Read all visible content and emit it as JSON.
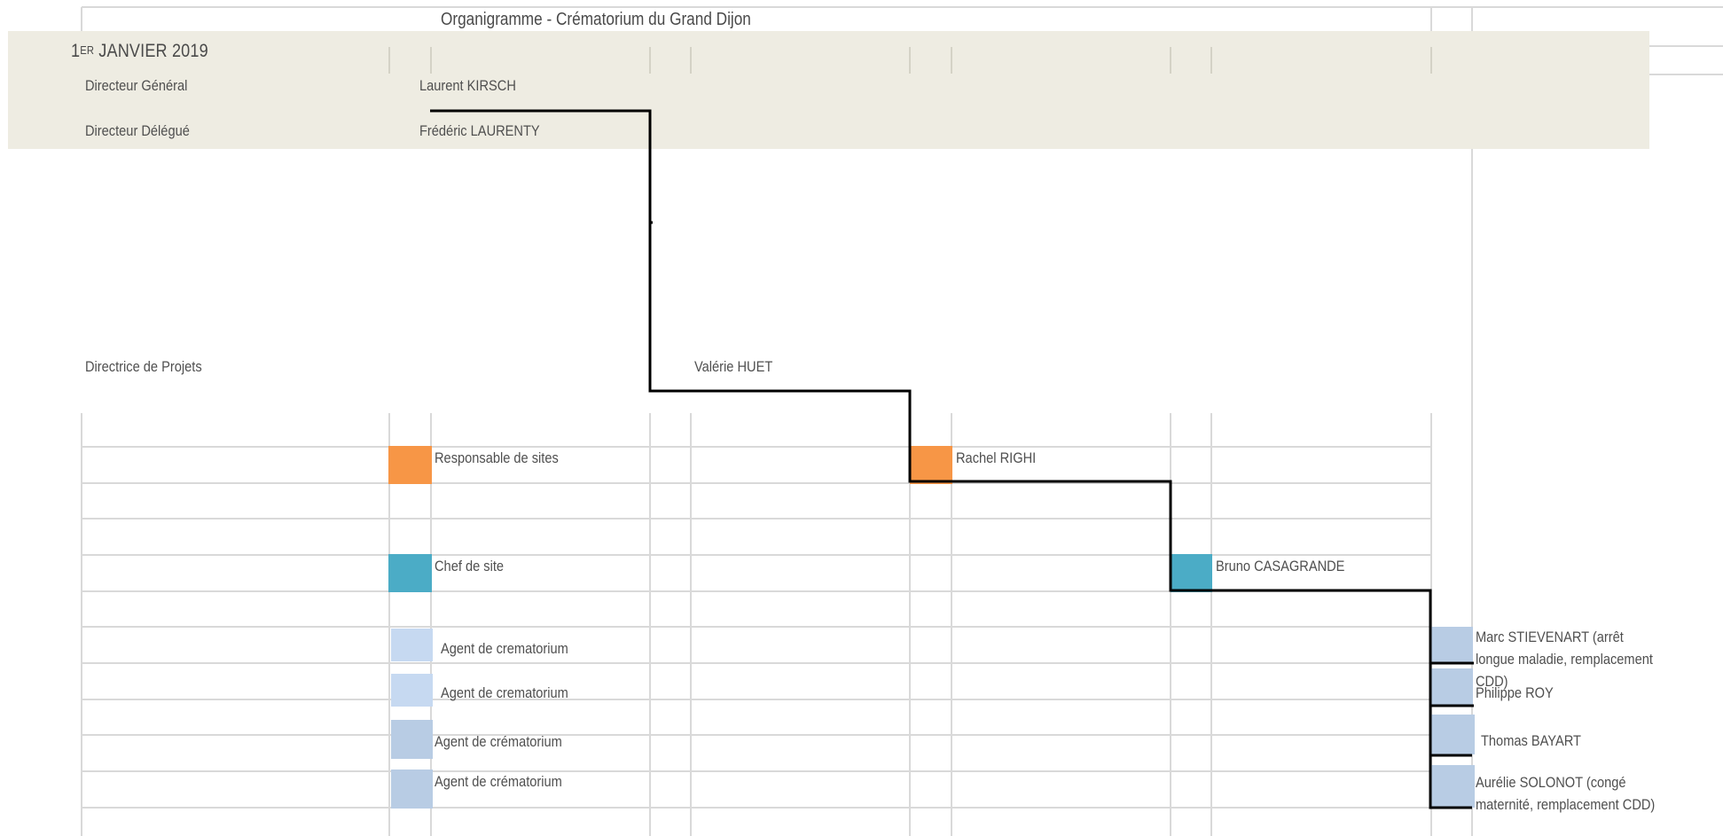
{
  "title": "Organigramme - Crématorium du Grand Dijon",
  "date": {
    "prefix": "1",
    "sup": "ER",
    "rest": " JANVIER 2019"
  },
  "colors": {
    "header_band": "#eeece2",
    "responsable": "#f79646",
    "chef": "#4bacc6",
    "agent_light": "#c6d9f1",
    "agent_mid": "#b8cce4",
    "grid": "#d9d9d9",
    "connector": "#000000"
  },
  "roles": {
    "directeur_general": {
      "label": "Directeur Général",
      "name": "Laurent KIRSCH"
    },
    "directeur_delegue": {
      "label": "Directeur Délégué",
      "name": "Frédéric LAURENTY"
    },
    "directrice_projets": {
      "label": "Directrice de Projets",
      "name": "Valérie HUET"
    }
  },
  "legend": [
    {
      "label": "Responsable de sites",
      "color_key": "responsable"
    },
    {
      "label": "Chef de site",
      "color_key": "chef"
    },
    {
      "label": "Agent de crematorium",
      "color_key": "agent_light"
    },
    {
      "label": "Agent de crematorium",
      "color_key": "agent_light"
    },
    {
      "label": "Agent de crématorium",
      "color_key": "agent_mid"
    },
    {
      "label": "Agent de crématorium",
      "color_key": "agent_mid"
    }
  ],
  "people": [
    {
      "name": "Rachel RIGHI",
      "color_key": "responsable"
    },
    {
      "name": "Bruno CASAGRANDE",
      "color_key": "chef"
    },
    {
      "name": "Marc STIEVENART (arrêt longue maladie, remplacement CDD)",
      "color_key": "agent_mid"
    },
    {
      "name": "Philippe ROY",
      "color_key": "agent_mid"
    },
    {
      "name": "Thomas BAYART",
      "color_key": "agent_mid"
    },
    {
      "name": "Aurélie SOLONOT (congé maternité, remplacement CDD)",
      "color_key": "agent_mid"
    }
  ]
}
